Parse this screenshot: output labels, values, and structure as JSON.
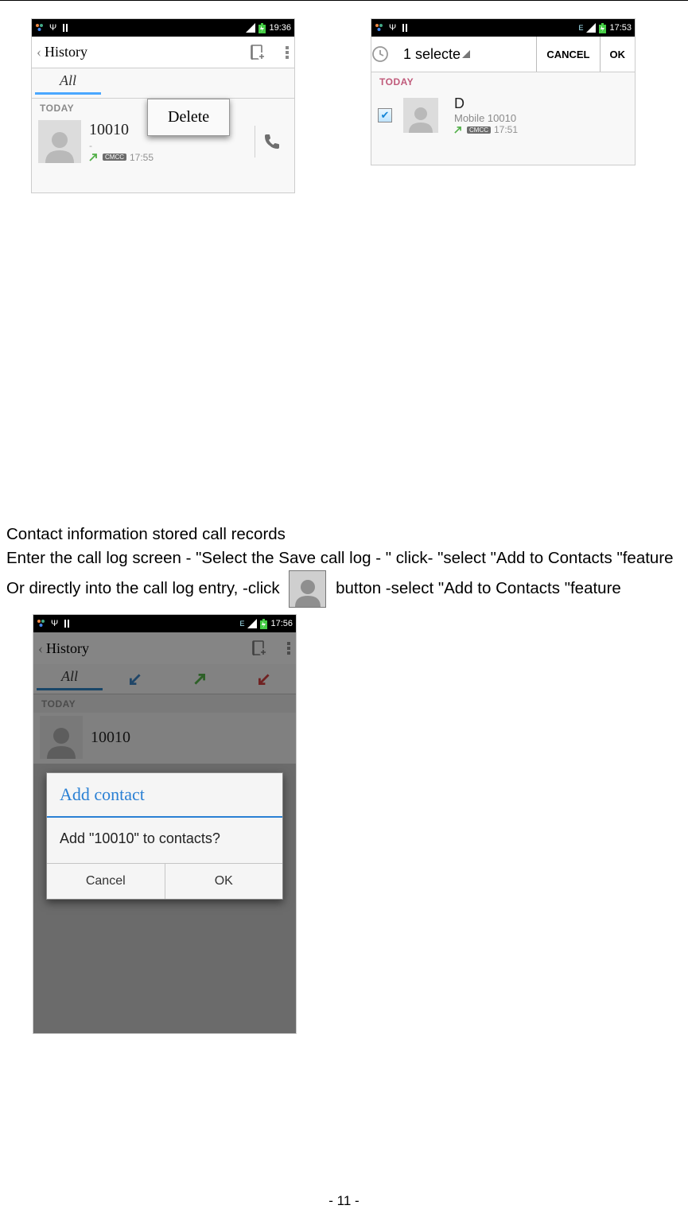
{
  "phone_a": {
    "status_time": "19:36",
    "header": "History",
    "tab_all": "All",
    "popup_delete": "Delete",
    "today": "TODAY",
    "entry_number": "10010",
    "entry_carrier": "CMCC",
    "entry_time": "17:55"
  },
  "phone_b": {
    "status_time": "17:53",
    "selected_text": "1 selecte",
    "cancel": "CANCEL",
    "ok": "OK",
    "today": "TODAY",
    "contact_letter": "D",
    "sub_number": "Mobile 10010",
    "entry_carrier": "CMCC",
    "entry_time": "17:51"
  },
  "body": {
    "l1": "Contact information stored call records",
    "l2": "Enter the call log screen - \"Select the Save call log - \" click- \"select \"Add to Contacts \"feature",
    "l3a": "Or directly into the call log entry, -click",
    "l3b": "button -select \"Add to Contacts \"feature"
  },
  "phone_c": {
    "status_time": "17:56",
    "header": "History",
    "tab_all": "All",
    "today": "TODAY",
    "entry_number": "10010",
    "dialog_title": "Add contact",
    "dialog_body": "Add \"10010\" to contacts?",
    "cancel": "Cancel",
    "ok": "OK"
  },
  "page_number": "- 11 -"
}
